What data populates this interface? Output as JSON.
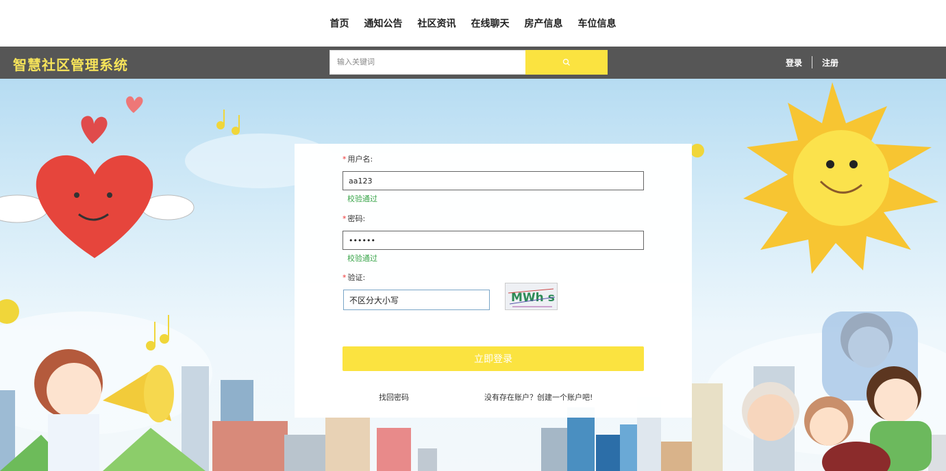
{
  "nav": {
    "items": [
      "首页",
      "通知公告",
      "社区资讯",
      "在线聊天",
      "房产信息",
      "车位信息"
    ]
  },
  "header": {
    "brand": "智慧社区管理系统",
    "search_placeholder": "输入关键词",
    "search_icon": "search-icon",
    "login": "登录",
    "register": "注册"
  },
  "form": {
    "username_label": "用户名:",
    "username_value": "aa123",
    "username_status": "校验通过",
    "password_label": "密码:",
    "password_value": "••••••",
    "password_status": "校验通过",
    "captcha_label": "验证:",
    "captcha_value": "不区分大小写",
    "captcha_text": "MWh s",
    "submit": "立即登录",
    "forgot": "找回密码",
    "signup": "没有存在账户？创建一个账户吧!"
  },
  "colors": {
    "accent": "#fbe340",
    "header_bg": "#565656",
    "brand": "#f7e45a",
    "success": "#3aa54a"
  }
}
